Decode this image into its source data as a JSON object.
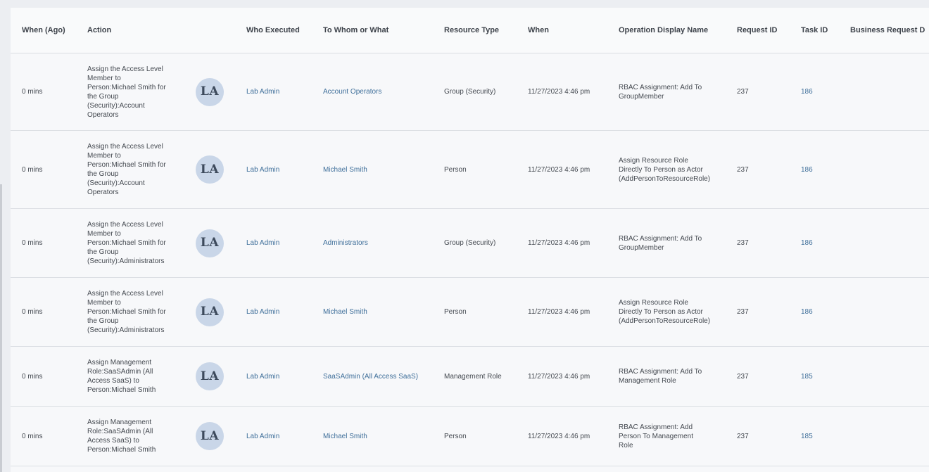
{
  "columns": {
    "when_ago": "When (Ago)",
    "action": "Action",
    "who_executed": "Who Executed",
    "to_whom": "To Whom or What",
    "resource_type": "Resource Type",
    "when": "When",
    "operation": "Operation Display Name",
    "request_id": "Request ID",
    "task_id": "Task ID",
    "business_request": "Business Request D"
  },
  "rows": [
    {
      "ago": "0 mins",
      "action": [
        "Assign the Access Level",
        "Member to",
        "Person:Michael Smith for",
        "the Group",
        "(Security):Account",
        "Operators"
      ],
      "avatar": "LA",
      "who": "Lab Admin",
      "target": "Account Operators",
      "resource_type": "Group (Security)",
      "when": "11/27/2023 4:46 pm",
      "operation": [
        "RBAC Assignment: Add To",
        "GroupMember"
      ],
      "request_id": "237",
      "task_id": "186"
    },
    {
      "ago": "0 mins",
      "action": [
        "Assign the Access Level",
        "Member to",
        "Person:Michael Smith for",
        "the Group",
        "(Security):Account",
        "Operators"
      ],
      "avatar": "LA",
      "who": "Lab Admin",
      "target": "Michael Smith",
      "resource_type": "Person",
      "when": "11/27/2023 4:46 pm",
      "operation": [
        "Assign Resource Role",
        "Directly To Person as Actor",
        "(AddPersonToResourceRole)"
      ],
      "request_id": "237",
      "task_id": "186"
    },
    {
      "ago": "0 mins",
      "action": [
        "Assign the Access Level",
        "Member to",
        "Person:Michael Smith for",
        "the Group",
        "(Security):Administrators"
      ],
      "avatar": "LA",
      "who": "Lab Admin",
      "target": "Administrators",
      "resource_type": "Group (Security)",
      "when": "11/27/2023 4:46 pm",
      "operation": [
        "RBAC Assignment: Add To",
        "GroupMember"
      ],
      "request_id": "237",
      "task_id": "186"
    },
    {
      "ago": "0 mins",
      "action": [
        "Assign the Access Level",
        "Member to",
        "Person:Michael Smith for",
        "the Group",
        "(Security):Administrators"
      ],
      "avatar": "LA",
      "who": "Lab Admin",
      "target": "Michael Smith",
      "resource_type": "Person",
      "when": "11/27/2023 4:46 pm",
      "operation": [
        "Assign Resource Role",
        "Directly To Person as Actor",
        "(AddPersonToResourceRole)"
      ],
      "request_id": "237",
      "task_id": "186"
    },
    {
      "ago": "0 mins",
      "action": [
        "Assign Management",
        "Role:SaaSAdmin (All",
        "Access SaaS) to",
        "Person:Michael Smith"
      ],
      "avatar": "LA",
      "who": "Lab Admin",
      "target": "SaaSAdmin (All Access SaaS)",
      "resource_type": "Management Role",
      "when": "11/27/2023 4:46 pm",
      "operation": [
        "RBAC Assignment: Add To",
        "Management Role"
      ],
      "request_id": "237",
      "task_id": "185"
    },
    {
      "ago": "0 mins",
      "action": [
        "Assign Management",
        "Role:SaaSAdmin (All",
        "Access SaaS) to",
        "Person:Michael Smith"
      ],
      "avatar": "LA",
      "who": "Lab Admin",
      "target": "Michael Smith",
      "resource_type": "Person",
      "when": "11/27/2023 4:46 pm",
      "operation": [
        "RBAC Assignment: Add",
        "Person To Management",
        "Role"
      ],
      "request_id": "237",
      "task_id": "185"
    }
  ]
}
